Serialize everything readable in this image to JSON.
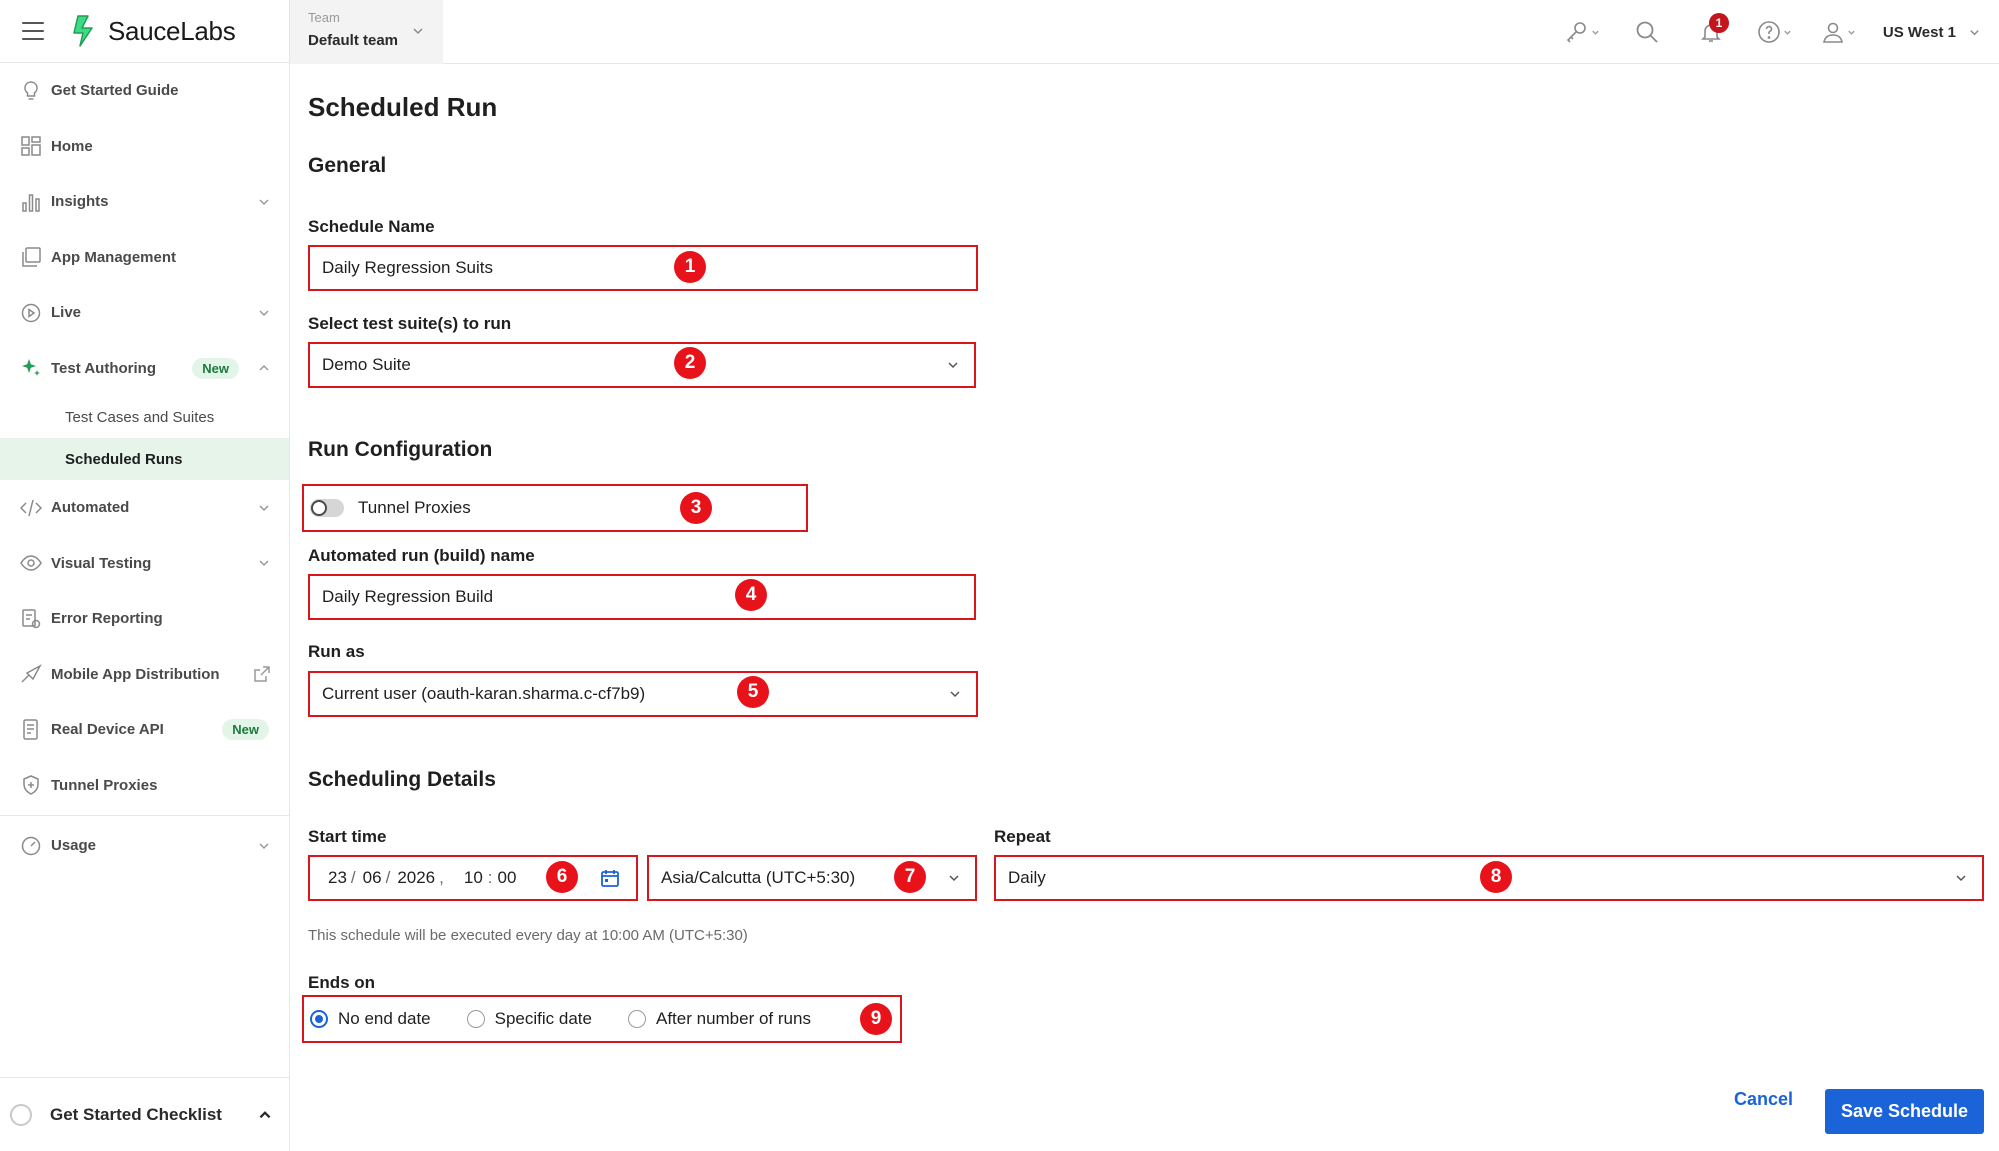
{
  "brand": {
    "name": "SauceLabs",
    "logo_color": "#3ddc84"
  },
  "team": {
    "caption": "Team",
    "value": "Default team"
  },
  "topbar": {
    "region": "US West 1",
    "notification_count": "1"
  },
  "sidebar": {
    "items": [
      {
        "label": "Get Started Guide"
      },
      {
        "label": "Home"
      },
      {
        "label": "Insights"
      },
      {
        "label": "App Management"
      },
      {
        "label": "Live"
      },
      {
        "label": "Test Authoring",
        "badge": "New"
      },
      {
        "label": "Automated"
      },
      {
        "label": "Visual Testing"
      },
      {
        "label": "Error Reporting"
      },
      {
        "label": "Mobile App Distribution"
      },
      {
        "label": "Real Device API",
        "badge": "New"
      },
      {
        "label": "Tunnel Proxies"
      },
      {
        "label": "Usage"
      }
    ],
    "subitems": [
      {
        "label": "Test Cases and Suites"
      },
      {
        "label": "Scheduled Runs",
        "active": true
      }
    ],
    "checklist": "Get Started Checklist"
  },
  "page": {
    "title": "Scheduled Run",
    "general": {
      "title": "General",
      "schedule_name_label": "Schedule Name",
      "schedule_name_value": "Daily Regression Suits",
      "suite_label": "Select test suite(s) to run",
      "suite_value": "Demo Suite"
    },
    "run_config": {
      "title": "Run Configuration",
      "tunnel_label": "Tunnel Proxies",
      "build_label": "Automated run (build) name",
      "build_value": "Daily Regression Build",
      "run_as_label": "Run as",
      "run_as_value": "Current user (oauth-karan.sharma.c-cf7b9)"
    },
    "scheduling": {
      "title": "Scheduling Details",
      "start_label": "Start time",
      "day": "23",
      "month": "06",
      "year": "2026",
      "hour": "10",
      "minute": "00",
      "timezone": "Asia/Calcutta (UTC+5:30)",
      "repeat_label": "Repeat",
      "repeat_value": "Daily",
      "hint": "This schedule will be executed every day at 10:00 AM (UTC+5:30)",
      "ends_label": "Ends on",
      "ends_options": [
        "No end date",
        "Specific date",
        "After number of runs"
      ]
    },
    "actions": {
      "cancel": "Cancel",
      "save": "Save Schedule"
    }
  },
  "markers": [
    "1",
    "2",
    "3",
    "4",
    "5",
    "6",
    "7",
    "8",
    "9"
  ],
  "colors": {
    "accent": "#1a63d8",
    "annotation": "#e8121b",
    "active_nav": "#e6f4ea"
  }
}
